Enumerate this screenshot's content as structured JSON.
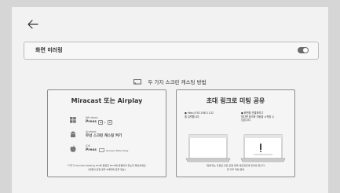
{
  "header": {
    "back_icon": "arrow-left-icon"
  },
  "mirroring": {
    "label": "화면 미러링",
    "toggle_state": "on"
  },
  "methods": {
    "title": "두 가지 스크린 캐스팅 방법",
    "icon": "cast-screen-icon"
  },
  "miracast_card": {
    "title": "Miracast 또는 Airplay",
    "windows": {
      "os": "Windows",
      "press_label": "Press",
      "keys": [
        "⊞",
        "K"
      ]
    },
    "android": {
      "os": "Android",
      "action": "무선 스크린 캐스팅 켜기"
    },
    "ios": {
      "os": "iOS",
      "press_label": "Press",
      "sub": "Screen Mirroring"
    },
    "note_line1": "*기기가 Samdas Meeting Pro와 동일한 Wi-Fi에 연결되어 있는지 확인하세요.",
    "note_line2": "(연결이 안될 경우 8세대에 갑을 정보)"
  },
  "link_card": {
    "title": "초대 링크로 미팅 공유",
    "left_bullet1": "● http://192.168.3.142",
    "left_bullet2": "을 입력합니다.",
    "right_bullet1": "● 화면을 연결하려고",
    "right_bullet2": "하다면 링크와 미팅을 시작할 수",
    "right_bullet3": "있습니다.",
    "note_line1": "*참여자는 다운로 같은 로컬 영역 네트워크에 있어야 합니다.",
    "note_line2": "연 다우 미팅 참여"
  }
}
